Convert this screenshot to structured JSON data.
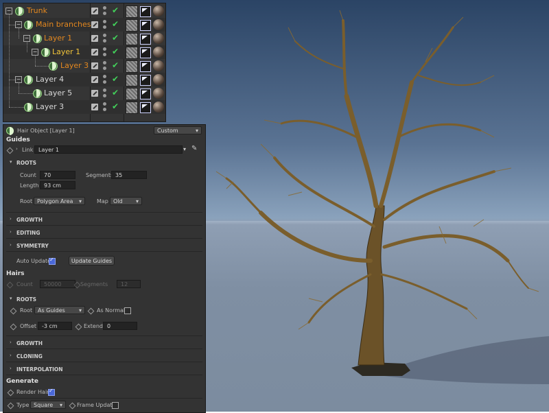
{
  "object_manager": {
    "objects": [
      {
        "name": "Trunk",
        "color": "#e4881f",
        "expanded": true
      },
      {
        "name": "Main branches",
        "color": "#e4881f",
        "expanded": true
      },
      {
        "name": "Layer 1",
        "color": "#e4881f",
        "expanded": true
      },
      {
        "name": "Layer 1",
        "color": "#f2c53a",
        "expanded": true
      },
      {
        "name": "Layer 3",
        "color": "#e4881f"
      },
      {
        "name": "Layer 4",
        "color": "#d8d8d8",
        "expanded": true
      },
      {
        "name": "Layer 5",
        "color": "#d8d8d8"
      },
      {
        "name": "Layer 3",
        "color": "#d8d8d8"
      }
    ],
    "icons": {
      "object": "hair-object-icon",
      "edit": "edit-icon",
      "visible": "checkmark-icon",
      "tags": [
        "texture-tag-icon",
        "hair-material-flag-icon",
        "material-sphere-icon"
      ]
    }
  },
  "attributes": {
    "title": "Hair Object [Layer 1]",
    "mode": "Custom",
    "guides": {
      "header": "Guides",
      "link_label": "Link",
      "link_value": "Layer 1",
      "roots_group": "ROOTS",
      "count_label": "Count",
      "count_value": "70",
      "segments_label": "Segments",
      "segments_value": "35",
      "length_label": "Length",
      "length_value": "93 cm",
      "root_label": "Root",
      "root_value": "Polygon Area",
      "map_label": "Map",
      "map_value": "Old",
      "groups": [
        "GROWTH",
        "EDITING",
        "SYMMETRY"
      ],
      "auto_update_label": "Auto Update",
      "auto_update": true,
      "update_button": "Update Guides"
    },
    "hairs": {
      "header": "Hairs",
      "count_label": "Count",
      "count_value": "50000",
      "segments_label": "Segments",
      "segments_value": "12",
      "roots_group": "ROOTS",
      "root_label": "Root",
      "root_value": "As Guides",
      "as_normal_label": "As Normal",
      "as_normal": false,
      "offset_label": "Offset",
      "offset_value": "-3 cm",
      "extend_label": "Extend",
      "extend_value": "0",
      "groups": [
        "GROWTH",
        "CLONING",
        "INTERPOLATION"
      ]
    },
    "generate": {
      "header": "Generate",
      "render_hairs_label": "Render Hairs",
      "render_hairs": true,
      "type_label": "Type",
      "type_value": "Square",
      "frame_update_label": "Frame Update",
      "frame_update": false
    }
  }
}
